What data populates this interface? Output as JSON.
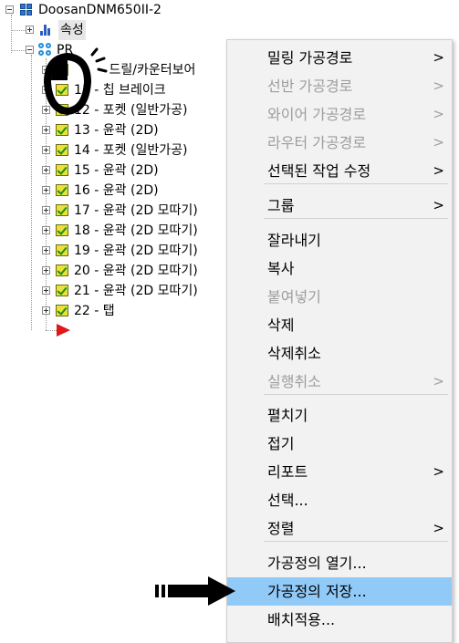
{
  "tree": {
    "root_label": "DoosanDNM650II-2",
    "properties_label": "속성",
    "program_label_partial": "PR",
    "operations": [
      {
        "label": "- 드릴/카운터보어"
      },
      {
        "label": "11 - 칩 브레이크"
      },
      {
        "label": "12 - 포켓 (일반가공)"
      },
      {
        "label": "13 - 윤곽 (2D)"
      },
      {
        "label": "14 - 포켓 (일반가공)"
      },
      {
        "label": "15 - 윤곽 (2D)"
      },
      {
        "label": "16 - 윤곽 (2D)"
      },
      {
        "label": "17 - 윤곽 (2D 모따기)"
      },
      {
        "label": "18 - 윤곽 (2D 모따기)"
      },
      {
        "label": "19 - 윤곽 (2D 모따기)"
      },
      {
        "label": "20 - 윤곽 (2D 모따기)"
      },
      {
        "label": "21 - 윤곽 (2D 모따기)"
      },
      {
        "label": "22 - 탭"
      }
    ]
  },
  "menu": {
    "items": [
      {
        "label": "밀링 가공경로",
        "disabled": false,
        "submenu": true
      },
      {
        "label": "선반 가공경로",
        "disabled": true,
        "submenu": true
      },
      {
        "label": "와이어 가공경로",
        "disabled": true,
        "submenu": true
      },
      {
        "label": "라우터 가공경로",
        "disabled": true,
        "submenu": true
      },
      {
        "label": "선택된 작업 수정",
        "disabled": false,
        "submenu": true
      },
      {
        "label": "그룹",
        "disabled": false,
        "submenu": true
      },
      {
        "label": "잘라내기",
        "disabled": false,
        "submenu": false
      },
      {
        "label": "복사",
        "disabled": false,
        "submenu": false
      },
      {
        "label": "붙여넣기",
        "disabled": true,
        "submenu": false
      },
      {
        "label": "삭제",
        "disabled": false,
        "submenu": false
      },
      {
        "label": "삭제취소",
        "disabled": false,
        "submenu": false
      },
      {
        "label": "실행취소",
        "disabled": true,
        "submenu": true
      },
      {
        "label": "펼치기",
        "disabled": false,
        "submenu": false
      },
      {
        "label": "접기",
        "disabled": false,
        "submenu": false
      },
      {
        "label": "리포트",
        "disabled": false,
        "submenu": true
      },
      {
        "label": "선택...",
        "disabled": false,
        "submenu": false
      },
      {
        "label": "정렬",
        "disabled": false,
        "submenu": true
      },
      {
        "label": "가공정의 열기...",
        "disabled": false,
        "submenu": false
      },
      {
        "label": "가공정의 저장...",
        "disabled": false,
        "submenu": false,
        "highlighted": true
      },
      {
        "label": "배치적용...",
        "disabled": false,
        "submenu": false
      }
    ],
    "submenu_chevron": ">"
  },
  "colors": {
    "menu_bg": "#f2f2f2",
    "highlight": "#91c9f7",
    "disabled_text": "#9d9d9d",
    "check_fill": "#e8e23a",
    "flag": "#e01818"
  }
}
